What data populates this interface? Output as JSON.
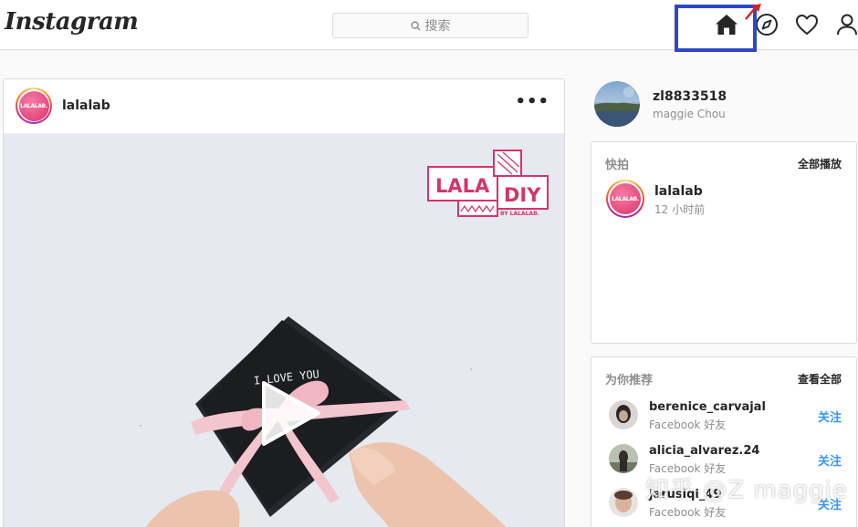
{
  "app": {
    "logo": "Instagram"
  },
  "search": {
    "placeholder": "搜索"
  },
  "nav": {
    "icons": [
      "home-icon",
      "compass-icon",
      "heart-icon",
      "person-icon"
    ],
    "highlight_color": "#2f48c4"
  },
  "post": {
    "username": "lalalab",
    "avatar_text": "LALALAB.",
    "more": "•••",
    "media": {
      "logo_left": "LALA",
      "logo_right": "DIY",
      "logo_sub": "BY LALALAB.",
      "card_text": "I LOVE YOU"
    }
  },
  "profile": {
    "username": "zl8833518",
    "fullname": "maggie Chou"
  },
  "stories": {
    "title": "快拍",
    "action": "全部播放",
    "items": [
      {
        "username": "lalalab",
        "avatar_text": "LALALAB.",
        "time": "12 小时前"
      }
    ]
  },
  "suggestions": {
    "title": "为你推荐",
    "action": "查看全部",
    "follow_label": "关注",
    "items": [
      {
        "username": "berenice_carvajal",
        "sub": "Facebook 好友"
      },
      {
        "username": "alicia_alvarez.24",
        "sub": "Facebook 好友"
      },
      {
        "username": "jarusiqi_49",
        "sub": "Facebook 好友"
      }
    ]
  },
  "watermark": "知乎 @Z maggie",
  "colors": {
    "accent_blue": "#3897f0",
    "brand_pink": "#d6336c",
    "border": "#dbdbdb"
  }
}
